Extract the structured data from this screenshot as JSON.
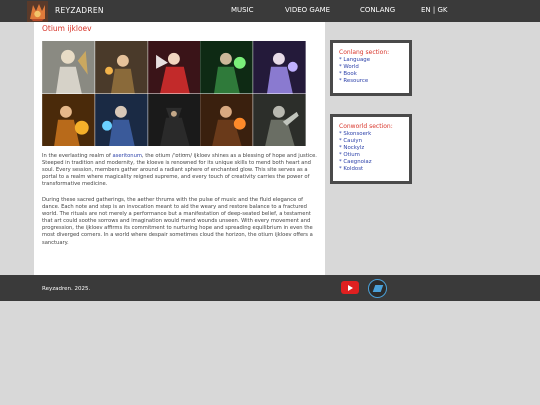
{
  "header": {
    "brand": "REYZADREN",
    "nav": [
      {
        "label": "MUSIC"
      },
      {
        "label": "VIDEO GAME"
      },
      {
        "label": "CONLANG"
      },
      {
        "label": "EN | GK"
      }
    ]
  },
  "main": {
    "title": "Otium ijkloev",
    "gallery_alt": [
      "paladin",
      "witch",
      "red mage",
      "green sorcerer",
      "purple mage",
      "fire bard",
      "water mage",
      "dark monk",
      "fire warrior",
      "armored knight"
    ],
    "p1_before_link": "In the everlasting realm of ",
    "p1_link": "aseritonum",
    "p1_after_link": ", the otium /ˈɒtiʊm/ ijkloev shines as a blessing of hope and justice. Steeped in tradition and modernity, the kloeve is renowned for its unique skills to mend both heart and soul. Every session, members gather around a radiant sphere of enchanted glow. This site serves as a portal to a realm where magicality reigned supreme, and every touch of creativity carries the power of transformative medicine.",
    "p2": "During these sacred gatherings, the aether thrums with the pulse of music and the fluid elegance of dance. Each note and step is an invocation meant to aid the weary and restore balance to a fractured world. The rituals are not merely a performance but a manifestation of deep-seated belief, a testament that art could soothe sorrows and imagination would mend wounds unseen. With every movement and progression, the ijkloev affirms its commitment to nurturing hope and spreading equilibrium in even the most diverged corners. In a world where despair sometimes cloud the horizon, the otium ijkloev offers a sanctuary."
  },
  "conlang": {
    "heading": "Conlang section:",
    "items": [
      "* Language",
      "* World",
      "* Book",
      "* Resource"
    ]
  },
  "conworld": {
    "heading": "Conworld section:",
    "items": [
      "* Skonsoerk",
      "* Cauiyn",
      "* Nockylz",
      "* Otium",
      "* Caegnoiaz",
      "* Koldost"
    ]
  },
  "footer": {
    "copyright": "Reyzadren. 2025."
  },
  "colors": {
    "accent_red": "#d8352a",
    "link_blue": "#2a3fa8",
    "bar_dark": "#3a3a3a",
    "youtube_red": "#e02020"
  },
  "icons": [
    "logo-icon",
    "youtube-icon",
    "blue-square-icon"
  ]
}
